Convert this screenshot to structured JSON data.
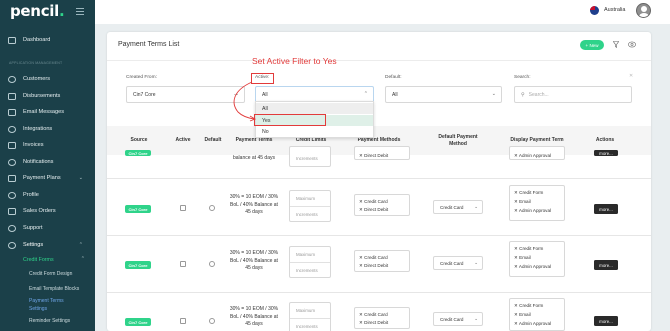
{
  "brand": {
    "logo_text": "pencil",
    "logo_dot": "."
  },
  "sidebar": {
    "section_label": "Application Management",
    "items": [
      {
        "label": "Dashboard",
        "icon": "dashboard-icon"
      },
      {
        "label": "Customers",
        "icon": "customers-icon"
      },
      {
        "label": "Disbursements",
        "icon": "disbursements-icon"
      },
      {
        "label": "Email Messages",
        "icon": "email-icon"
      },
      {
        "label": "Integrations",
        "icon": "integrations-icon"
      },
      {
        "label": "Invoices",
        "icon": "invoices-icon"
      },
      {
        "label": "Notifications",
        "icon": "bell-icon"
      },
      {
        "label": "Payment Plans",
        "icon": "payment-plans-icon"
      },
      {
        "label": "Profile",
        "icon": "profile-icon"
      },
      {
        "label": "Sales Orders",
        "icon": "sales-orders-icon"
      },
      {
        "label": "Support",
        "icon": "support-icon"
      },
      {
        "label": "Settings",
        "icon": "settings-icon"
      }
    ],
    "sub_item": "Credit Forms",
    "sub_sub_items": [
      "Credit Form Design",
      "Email Template Blocks",
      "Payment Terms Settings",
      "Reminder Settings"
    ]
  },
  "topbar": {
    "country": "Australia"
  },
  "card": {
    "title": "Payment Terms List",
    "new_button": "New"
  },
  "filters": {
    "created_from_label": "Created From:",
    "created_from_value": "Cin7 Core",
    "active_label": "Active:",
    "active_value": "All",
    "default_label": "Default:",
    "default_value": "All",
    "search_label": "Search:",
    "search_placeholder": "Search...",
    "dash": "–"
  },
  "dropdown": {
    "options": [
      "All",
      "Yes",
      "No"
    ]
  },
  "annotation": {
    "text": "Set Active Filter to Yes"
  },
  "table": {
    "headers": [
      "Source",
      "Active",
      "Default",
      "Payment Terms",
      "Credit Limits",
      "Payment Methods",
      "Default Payment Method",
      "Display Payment Term",
      "Actions"
    ],
    "rows": [
      {
        "source": "Cin7 Core",
        "terms": "balance at 45 days",
        "limit_bottom": "Increments",
        "methods": [
          "Direct Debit"
        ],
        "display": [
          "Admin Approval"
        ],
        "action": "more..."
      },
      {
        "source": "Cin7 Core",
        "terms": "30% = 10 EOM / 30% BoL / 40% Balance at 45 days",
        "limit_top": "Maximum",
        "limit_bottom": "Increments",
        "methods": [
          "Credit Card",
          "Direct Debit"
        ],
        "default_method": "Credit Card",
        "display": [
          "Credit Form",
          "Email",
          "Admin Approval"
        ],
        "action": "more..."
      },
      {
        "source": "Cin7 Core",
        "terms": "30% = 10 EOM / 30% BoL / 40% Balance at 45 days",
        "limit_top": "Maximum",
        "limit_bottom": "Increments",
        "methods": [
          "Credit Card",
          "Direct Debit"
        ],
        "default_method": "Credit Card",
        "display": [
          "Credit Form",
          "Email",
          "Admin Approval"
        ],
        "action": "more..."
      },
      {
        "source": "Cin7 Core",
        "terms": "30% = 10 EOM / 30% BoL / 40% Balance at 45 days",
        "limit_top": "Maximum",
        "limit_bottom": "Increments",
        "methods": [
          "Credit Card",
          "Direct Debit"
        ],
        "default_method": "Credit Card",
        "display": [
          "Credit Form",
          "Email",
          "Admin Approval"
        ],
        "action": "more..."
      }
    ]
  },
  "colors": {
    "accent": "#2fd38a",
    "sidebar": "#1b4049",
    "annotation": "#e23b3b"
  }
}
